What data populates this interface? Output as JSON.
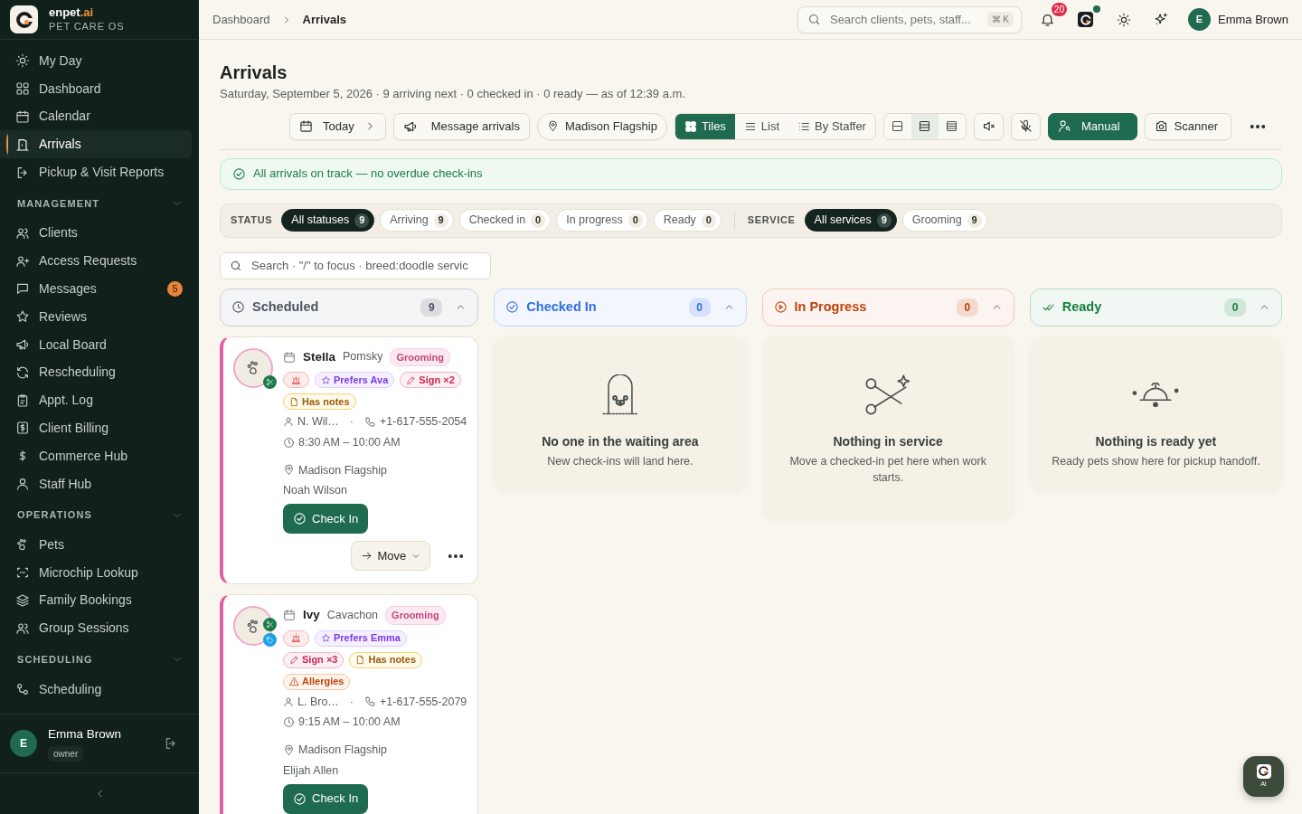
{
  "brand": {
    "name": "enpet",
    "suffix": ".ai",
    "tagline": "PET CARE OS"
  },
  "sidebar": {
    "sections": [
      {
        "items": [
          {
            "label": "My Day",
            "selected": false
          },
          {
            "label": "Dashboard",
            "selected": false
          },
          {
            "label": "Calendar",
            "selected": false
          },
          {
            "label": "Arrivals",
            "selected": true
          },
          {
            "label": "Pickup & Visit Reports",
            "selected": false
          }
        ]
      },
      {
        "heading": "MANAGEMENT",
        "expanded": true,
        "items": [
          {
            "label": "Clients",
            "selected": false
          },
          {
            "label": "Access Requests",
            "selected": false
          },
          {
            "label": "Messages",
            "selected": false,
            "badge": "5"
          },
          {
            "label": "Reviews",
            "selected": false
          },
          {
            "label": "Local Board",
            "selected": false
          },
          {
            "label": "Rescheduling",
            "selected": false
          },
          {
            "label": "Appt. Log",
            "selected": false
          },
          {
            "label": "Client Billing",
            "selected": false
          },
          {
            "label": "Commerce Hub",
            "selected": false
          },
          {
            "label": "Staff Hub",
            "selected": false
          }
        ]
      },
      {
        "heading": "OPERATIONS",
        "expanded": true,
        "items": [
          {
            "label": "Pets",
            "selected": false
          },
          {
            "label": "Microchip Lookup",
            "selected": false
          },
          {
            "label": "Family Bookings",
            "selected": false
          },
          {
            "label": "Group Sessions",
            "selected": false
          }
        ]
      },
      {
        "heading": "SCHEDULING",
        "expanded": true,
        "items": [
          {
            "label": "Scheduling",
            "selected": false
          }
        ]
      }
    ],
    "user": {
      "initial": "E",
      "name": "Emma Brown",
      "role": "owner"
    }
  },
  "breadcrumb": [
    {
      "label": "Dashboard",
      "current": false
    },
    {
      "label": "Arrivals",
      "current": true
    }
  ],
  "topbar": {
    "search_placeholder": "Search clients, pets, staff...",
    "shortcut": "⌘ K",
    "notification_count": "20",
    "assistant_online": true,
    "user": {
      "initial": "E",
      "name": "Emma Brown"
    }
  },
  "page": {
    "title": "Arrivals",
    "subtitle": "Saturday, September 5, 2026 · 9 arriving next · 0 checked in · 0 ready — as of 12:39 a.m."
  },
  "toolbar": {
    "date": "Today",
    "message": "Message arrivals",
    "location": "Madison Flagship",
    "views": [
      {
        "label": "Tiles",
        "selected": true
      },
      {
        "label": "List",
        "selected": false
      },
      {
        "label": "By Staffer",
        "selected": false
      }
    ],
    "density": [
      {
        "selected": false
      },
      {
        "selected": true
      },
      {
        "selected": false
      }
    ],
    "sound_muted": true,
    "mic_muted": true,
    "manual": "Manual",
    "scanner": "Scanner"
  },
  "banner": {
    "text": "All arrivals on track — no overdue check-ins"
  },
  "filters": {
    "status_label": "STATUS",
    "statuses": [
      {
        "label": "All statuses",
        "count": "9",
        "selected": true
      },
      {
        "label": "Arriving",
        "count": "9",
        "selected": false
      },
      {
        "label": "Checked in",
        "count": "0",
        "selected": false
      },
      {
        "label": "In progress",
        "count": "0",
        "selected": false
      },
      {
        "label": "Ready",
        "count": "0",
        "selected": false
      }
    ],
    "service_label": "SERVICE",
    "services": [
      {
        "label": "All services",
        "count": "9",
        "selected": true
      },
      {
        "label": "Grooming",
        "count": "9",
        "selected": false
      }
    ]
  },
  "board_search": {
    "placeholder": "Search · \"/\" to focus · breed:doodle servic"
  },
  "columns": [
    {
      "title": "Scheduled",
      "count": "9",
      "color": "#4b5563",
      "expanded": true,
      "cards": [
        {
          "pet": "Stella",
          "breed": "Pomsky",
          "service": "Grooming",
          "color": "#e0609f",
          "tagged": false,
          "tags": [
            {
              "kind": "alert"
            },
            {
              "kind": "prefers",
              "label": "Prefers Ava"
            },
            {
              "kind": "sign",
              "label": "Sign ×2"
            },
            {
              "kind": "notes",
              "label": "Has notes"
            }
          ],
          "owner": "N. Wil…",
          "separator": "·",
          "phone": "+1-617-555-2054",
          "time": "8:30 AM – 10:00 AM",
          "location": "Madison Flagship",
          "staff": "Noah Wilson",
          "action": "Check In",
          "move": "Move"
        },
        {
          "pet": "Ivy",
          "breed": "Cavachon",
          "service": "Grooming",
          "color": "#e0609f",
          "tagged": true,
          "tags": [
            {
              "kind": "alert"
            },
            {
              "kind": "prefers",
              "label": "Prefers Emma"
            },
            {
              "kind": "sign",
              "label": "Sign ×3"
            },
            {
              "kind": "notes",
              "label": "Has notes"
            },
            {
              "kind": "allergies",
              "label": "Allergies"
            }
          ],
          "owner": "L. Bro…",
          "separator": "·",
          "phone": "+1-617-555-2079",
          "time": "9:15 AM – 10:00 AM",
          "location": "Madison Flagship",
          "staff": "Elijah Allen",
          "action": "Check In"
        }
      ]
    },
    {
      "title": "Checked In",
      "count": "0",
      "color": "#2f6fdf",
      "expanded": true,
      "empty": {
        "kind": "waiting",
        "title": "No one in the waiting area",
        "text": "New check-ins will land here."
      }
    },
    {
      "title": "In Progress",
      "count": "0",
      "color": "#c2410c",
      "expanded": true,
      "empty": {
        "kind": "service",
        "title": "Nothing in service",
        "text": "Move a checked-in pet here when work starts."
      }
    },
    {
      "title": "Ready",
      "count": "0",
      "color": "#15803d",
      "expanded": true,
      "empty": {
        "kind": "ready",
        "title": "Nothing is ready yet",
        "text": "Ready pets show here for pickup handoff."
      }
    }
  ],
  "ai_button": {
    "label": "AI"
  }
}
